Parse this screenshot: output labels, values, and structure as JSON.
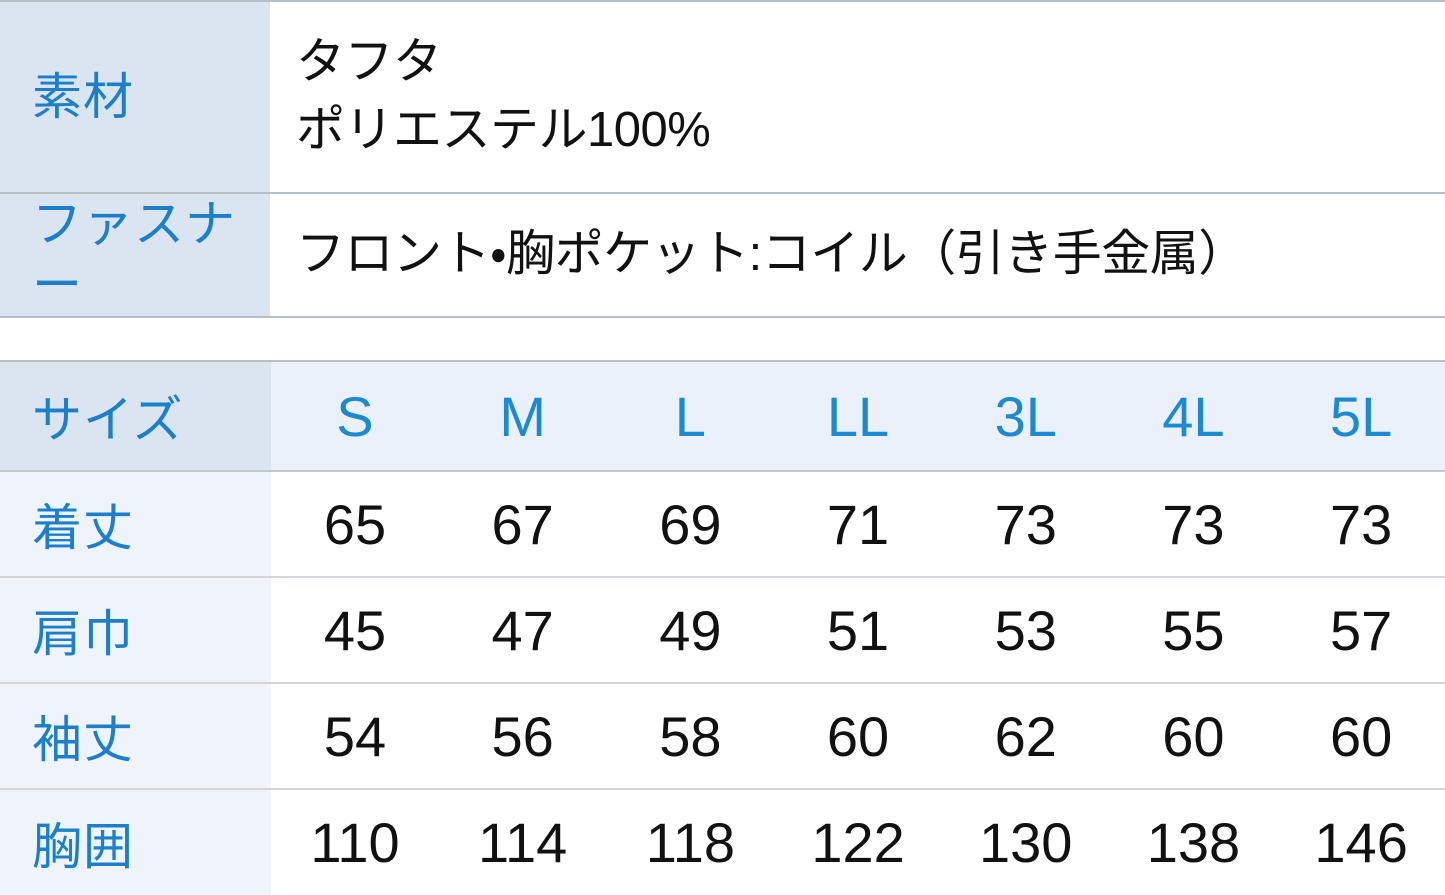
{
  "spec_table": {
    "rows": [
      {
        "label": "素材",
        "value": "タフタ\nポリエステル100%"
      },
      {
        "label": "ファスナー",
        "value": "フロント・胸ポケット:コイル（引き手金属）"
      }
    ]
  },
  "size_table": {
    "header": {
      "label": "サイズ",
      "sizes": [
        "S",
        "M",
        "L",
        "LL",
        "3L",
        "4L",
        "5L"
      ]
    },
    "rows": [
      {
        "label": "着丈",
        "values": [
          "65",
          "67",
          "69",
          "71",
          "73",
          "73",
          "73"
        ]
      },
      {
        "label": "肩巾",
        "values": [
          "45",
          "47",
          "49",
          "51",
          "53",
          "55",
          "57"
        ]
      },
      {
        "label": "袖丈",
        "values": [
          "54",
          "56",
          "58",
          "60",
          "62",
          "60",
          "60"
        ]
      },
      {
        "label": "胸囲",
        "values": [
          "110",
          "114",
          "118",
          "122",
          "130",
          "138",
          "146"
        ]
      }
    ]
  },
  "colors": {
    "label_blue_bg": "#dbe5f2",
    "header_cell_bg": "#eaf1fa",
    "body_label_bg": "#eff4fb",
    "accent_blue_text": "#1b7fcc",
    "header_blue_text": "#1b8ad1",
    "value_text": "#111111",
    "rule_strong": "#b9bfc6",
    "rule_light": "#d2d6da",
    "page_bg": "#ffffff"
  }
}
